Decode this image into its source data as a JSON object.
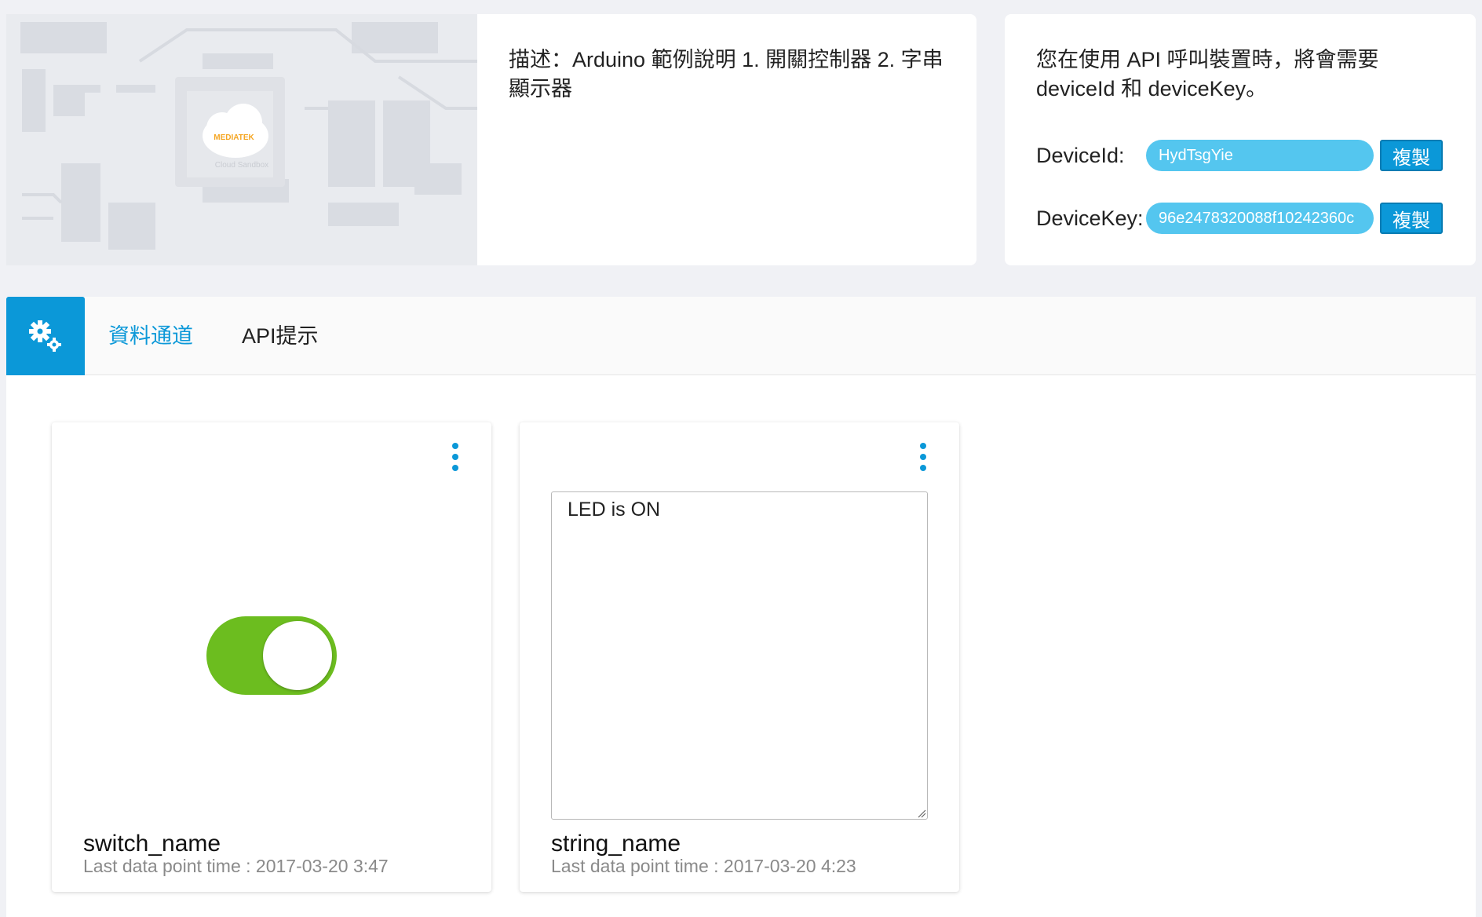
{
  "header": {
    "board_image": {
      "brand_text": "MEDIATEK",
      "sub_text": "Cloud Sandbox"
    },
    "description": "描述：Arduino 範例說明 1. 開關控制器 2. 字串顯示器",
    "api": {
      "intro": "您在使用 API 呼叫裝置時，將會需要 deviceId 和 deviceKey。",
      "device_id_label": "DeviceId:",
      "device_id_value": "HydTsgYie",
      "device_key_label": "DeviceKey:",
      "device_key_value": "96e2478320088f10242360c",
      "copy_label": "複製"
    }
  },
  "tabs": {
    "settings_icon": "gears-icon",
    "data_channels": "資料通道",
    "api_hints": "API提示"
  },
  "cards": [
    {
      "name": "switch_name",
      "last_time": "Last data point time : 2017-03-20 3:47",
      "type": "switch",
      "state": "on"
    },
    {
      "name": "string_name",
      "last_time": "Last data point time : 2017-03-20 4:23",
      "type": "string",
      "value": "LED is ON"
    }
  ],
  "colors": {
    "accent": "#0b98d8",
    "pill": "#54c6ef",
    "toggle_on": "#6cbd1f",
    "page_bg": "#f0f1f5"
  }
}
